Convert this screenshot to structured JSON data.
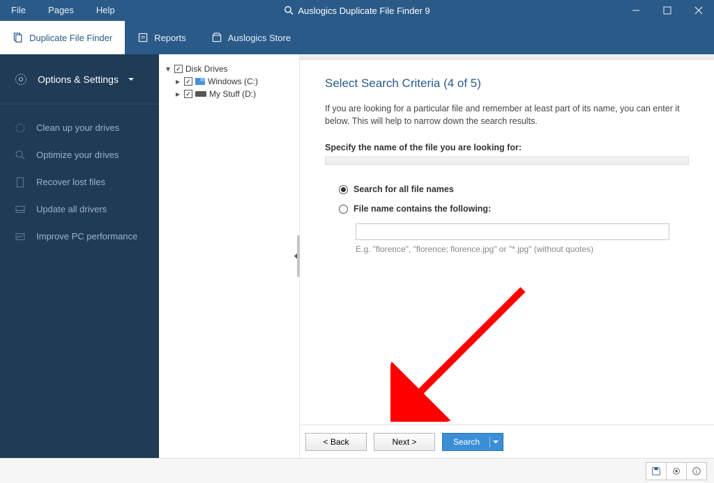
{
  "titlebar": {
    "menus": {
      "file": "File",
      "pages": "Pages",
      "help": "Help"
    },
    "app_title": "Auslogics Duplicate File Finder 9"
  },
  "tabs": {
    "dff": "Duplicate File Finder",
    "reports": "Reports",
    "store": "Auslogics Store"
  },
  "sidebar": {
    "options": "Options & Settings",
    "items": [
      "Clean up your drives",
      "Optimize your drives",
      "Recover lost files",
      "Update all drivers",
      "Improve PC performance"
    ]
  },
  "tree": {
    "root": "Disk Drives",
    "drives": [
      {
        "label": "Windows (C:)"
      },
      {
        "label": "My Stuff (D:)"
      }
    ]
  },
  "main": {
    "heading": "Select Search Criteria (4 of 5)",
    "description": "If you are looking for a particular file and remember at least part of its name, you can enter it below. This will help to narrow down the search results.",
    "section_label": "Specify the name of the file you are looking for:",
    "radio_all": "Search for all file names",
    "radio_contains": "File name contains the following:",
    "input_value": "",
    "hint": "E.g. \"florence\", \"florence; florence.jpg\" or \"*.jpg\" (without quotes)"
  },
  "buttons": {
    "back": "< Back",
    "next": "Next >",
    "search": "Search"
  }
}
